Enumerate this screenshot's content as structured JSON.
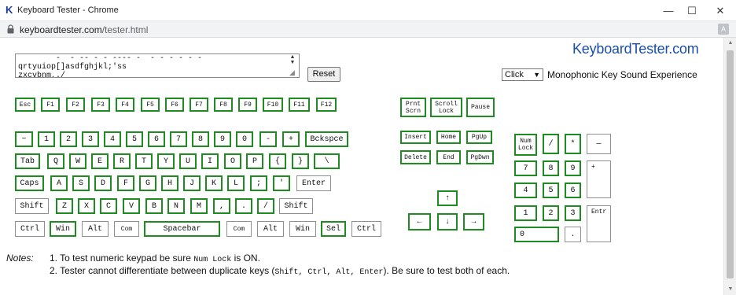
{
  "window": {
    "app_icon": "K",
    "title": "Keyboard Tester - Chrome",
    "minimize_glyph": "—",
    "maximize_glyph": "☐",
    "close_glyph": "✕"
  },
  "address": {
    "domain": "keyboardtester.com",
    "path": "/tester.html",
    "translate_icon": "translate-icon"
  },
  "page": {
    "brand": "KeyboardTester.com",
    "textarea_text": "        -  - -- - - ---- -  - - - - - -\nqrtyuiop[]asdfghjkl;'ss\nzxcvbnm,./",
    "reset_label": "Reset",
    "select_value": "Click",
    "sound_label": "Monophonic Key Sound Experience"
  },
  "keys": {
    "esc": "Esc",
    "f1": "F1",
    "f2": "F2",
    "f3": "F3",
    "f4": "F4",
    "f5": "F5",
    "f6": "F6",
    "f7": "F7",
    "f8": "F8",
    "f9": "F9",
    "f10": "F10",
    "f11": "F11",
    "f12": "F12",
    "prtsc": "Prnt\nScrn",
    "scrolllock": "Scroll\nLock",
    "pause": "Pause",
    "tilde": "~",
    "d1": "1",
    "d2": "2",
    "d3": "3",
    "d4": "4",
    "d5": "5",
    "d6": "6",
    "d7": "7",
    "d8": "8",
    "d9": "9",
    "d0": "0",
    "minus": "-",
    "plus": "+",
    "backspace": "Bckspce",
    "tab": "Tab",
    "q": "Q",
    "w": "W",
    "e": "E",
    "r": "R",
    "t": "T",
    "y": "Y",
    "u": "U",
    "i": "I",
    "o": "O",
    "p": "P",
    "lbrace": "{",
    "rbrace": "}",
    "backslash": "\\",
    "caps": "Caps",
    "a": "A",
    "s": "S",
    "d": "D",
    "f": "F",
    "g": "G",
    "h": "H",
    "j": "J",
    "k": "K",
    "l": "L",
    "semicolon": ";",
    "quote": "'",
    "enter": "Enter",
    "lshift": "Shift",
    "z": "Z",
    "x": "X",
    "c": "C",
    "v": "V",
    "b": "B",
    "n": "N",
    "m": "M",
    "comma": ",",
    "period": ".",
    "slash": "/",
    "rshift": "Shift",
    "lctrl": "Ctrl",
    "lwin": "Win",
    "lalt": "Alt",
    "lcom": "Com",
    "space": "Spacebar",
    "rcom": "Com",
    "ralt": "Alt",
    "rwin": "Win",
    "sel": "Sel",
    "rctrl": "Ctrl",
    "insert": "Insert",
    "home": "Home",
    "pgup": "PgUp",
    "delete": "Delete",
    "end": "End",
    "pgdn": "PgDwn",
    "up": "↑",
    "left": "←",
    "down": "↓",
    "right": "→",
    "numlock": "Num\nLock",
    "kp_div": "/",
    "kp_mul": "*",
    "kp_minus": "—",
    "kp7": "7",
    "kp8": "8",
    "kp9": "9",
    "kp_plus": "+",
    "kp4": "4",
    "kp5": "5",
    "kp6": "6",
    "kp1": "1",
    "kp2": "2",
    "kp3": "3",
    "kp_enter": "Entr",
    "kp0": "0",
    "kp_dot": "."
  },
  "notes": {
    "label": "Notes:",
    "n1_pre": "1. To test numeric keypad be sure ",
    "n1_code": "Num Lock",
    "n1_post": " is ON.",
    "n2_pre": "2. Tester cannot differentiate between duplicate keys (",
    "n2_code": "Shift, Ctrl, Alt, Enter",
    "n2_post": "). Be sure to test both of each."
  }
}
